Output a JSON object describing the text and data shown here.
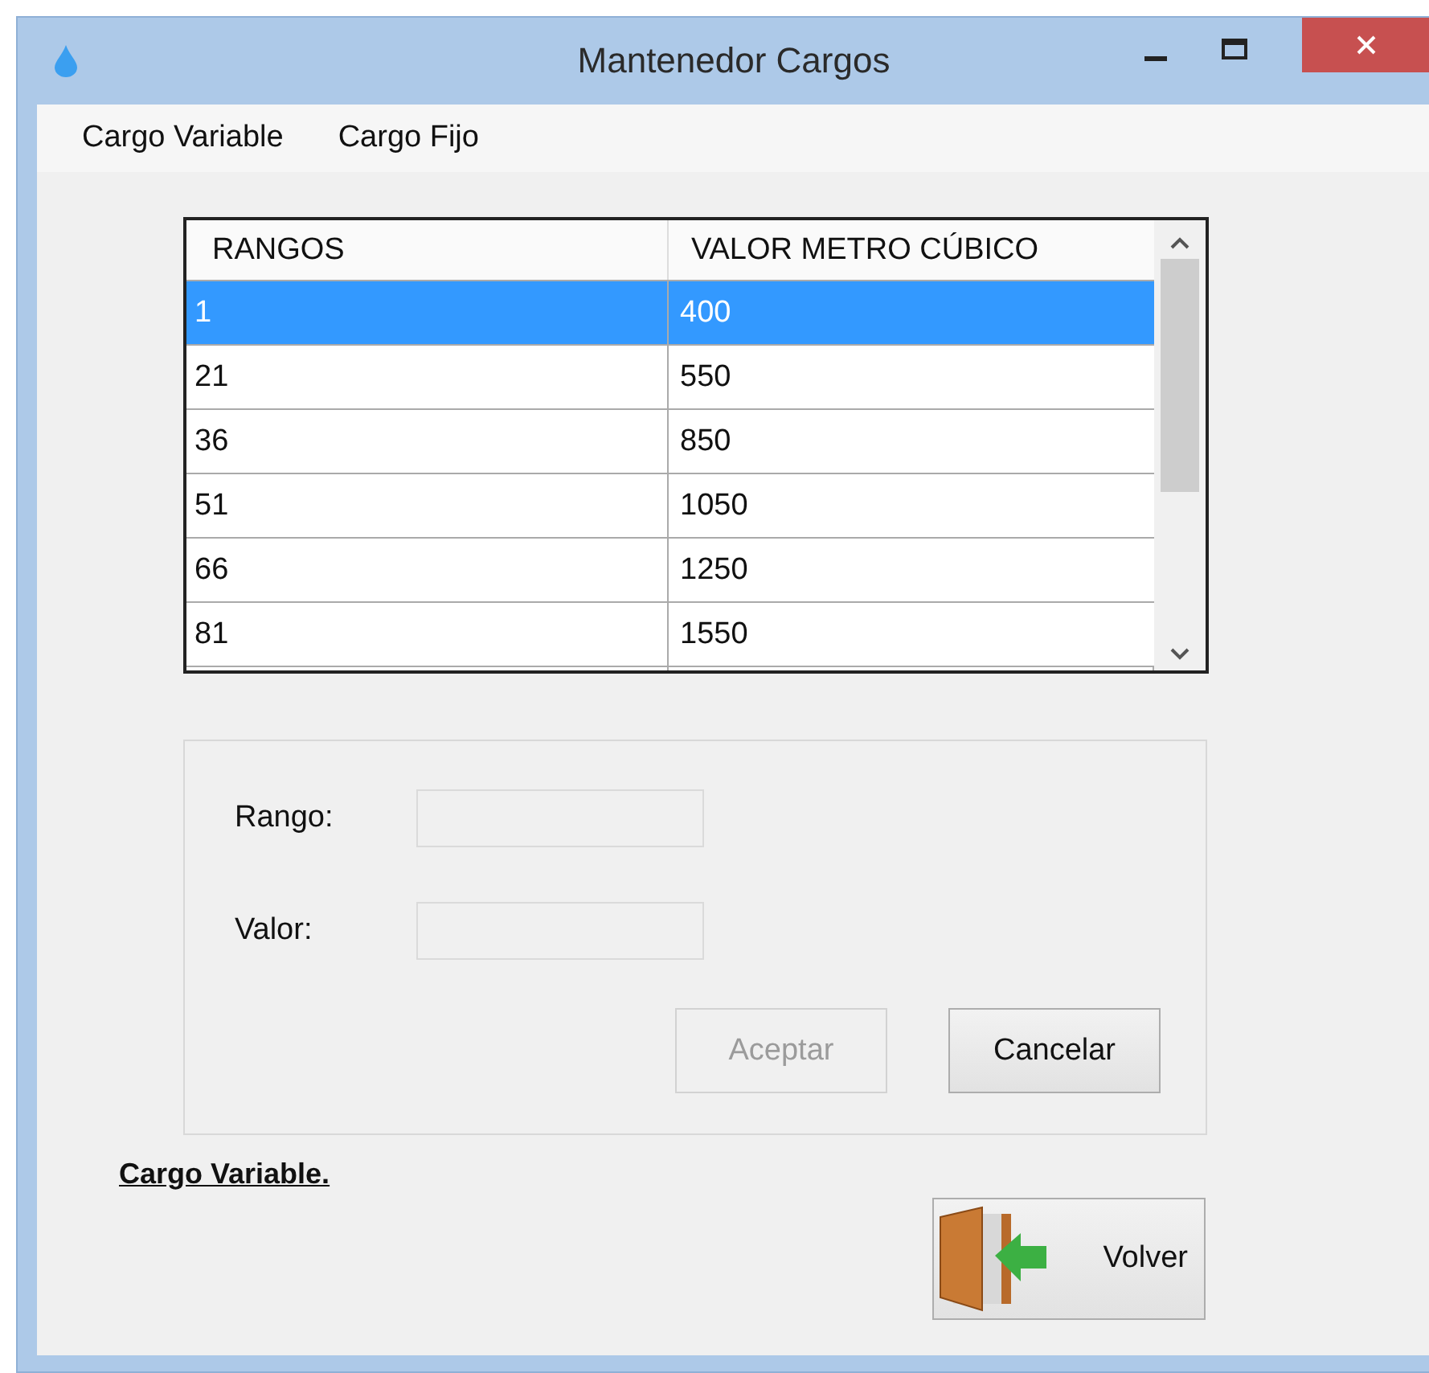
{
  "window": {
    "title": "Mantenedor Cargos"
  },
  "menu": [
    {
      "label": "Cargo Variable"
    },
    {
      "label": "Cargo Fijo"
    }
  ],
  "table": {
    "columns": [
      "RANGOS",
      "VALOR METRO CÚBICO"
    ],
    "rows": [
      {
        "cells": [
          "1",
          "400"
        ],
        "selected": true
      },
      {
        "cells": [
          "21",
          "550"
        ],
        "selected": false
      },
      {
        "cells": [
          "36",
          "850"
        ],
        "selected": false
      },
      {
        "cells": [
          "51",
          "1050"
        ],
        "selected": false
      },
      {
        "cells": [
          "66",
          "1250"
        ],
        "selected": false
      },
      {
        "cells": [
          "81",
          "1550"
        ],
        "selected": false
      }
    ]
  },
  "form": {
    "fields": [
      {
        "label": "Rango:",
        "disabled": true
      },
      {
        "label": "Valor:",
        "disabled": true
      }
    ],
    "buttons": [
      {
        "label": "Aceptar",
        "disabled": true
      },
      {
        "label": "Cancelar",
        "disabled": false
      }
    ]
  },
  "section_label": "Cargo Variable.",
  "back_button": {
    "label": "Volver"
  }
}
